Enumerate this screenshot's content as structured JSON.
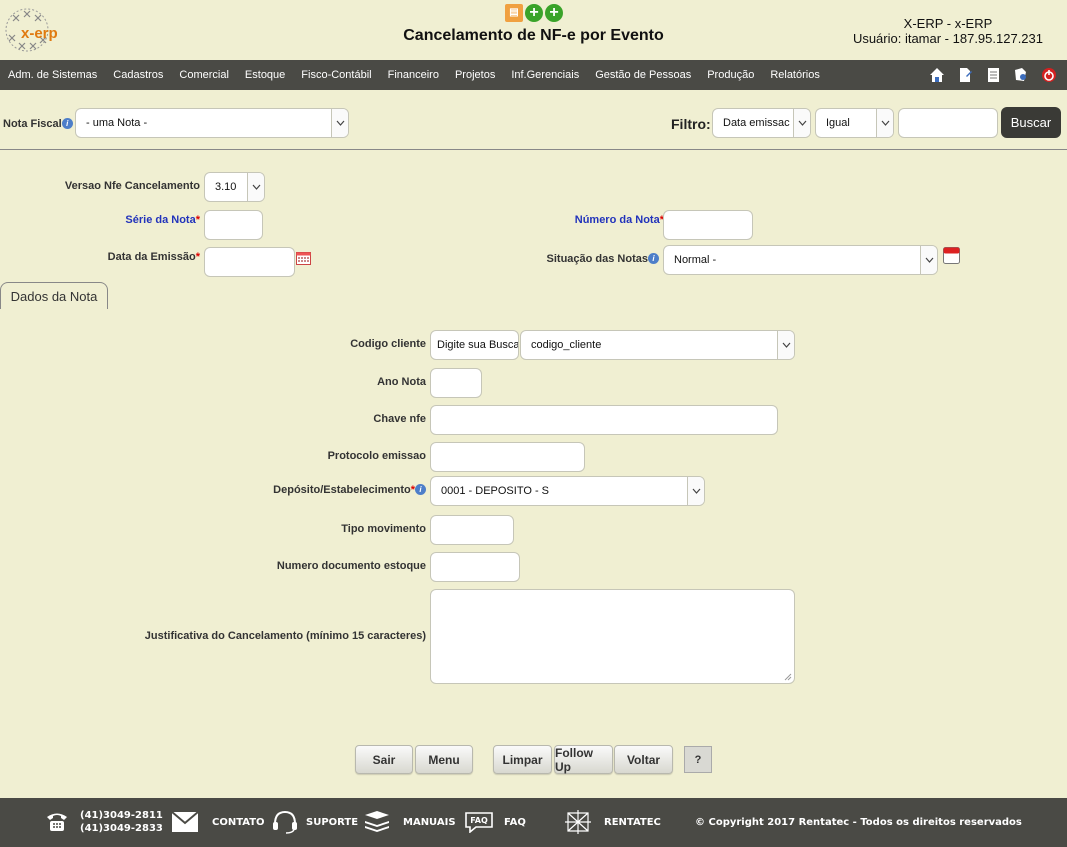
{
  "header": {
    "logo_text": "x-erp",
    "title": "Cancelamento de NF-e por Evento",
    "system": "X-ERP - x-ERP",
    "user": "Usuário: itamar - 187.95.127.231"
  },
  "menu": {
    "items": [
      "Adm. de Sistemas",
      "Cadastros",
      "Comercial",
      "Estoque",
      "Fisco-Contábil",
      "Financeiro",
      "Projetos",
      "Inf.Gerenciais",
      "Gestão de Pessoas",
      "Produção",
      "Relatórios"
    ],
    "icons": [
      "home-icon",
      "document-edit-icon",
      "document-icon",
      "search-docs-icon",
      "power-icon"
    ]
  },
  "filterbar": {
    "nota_label": "Nota Fiscal",
    "nota_value": "- uma Nota -",
    "filtro_label": "Filtro:",
    "filtro_field": "Data emissac",
    "filtro_op": "Igual",
    "filtro_value": "",
    "buscar_label": "Buscar"
  },
  "form": {
    "versao_label": "Versao Nfe Cancelamento",
    "versao_value": "3.10",
    "serie_label": "Série da Nota",
    "numero_label": "Número da Nota",
    "data_label": "Data da Emissão",
    "situacao_label": "Situação das Notas",
    "situacao_value": "Normal -"
  },
  "tab": {
    "label": "Dados da Nota"
  },
  "dados": {
    "codigo_label": "Codigo cliente",
    "codigo_search_placeholder": "Digite sua Busca",
    "codigo_select": "codigo_cliente",
    "ano_label": "Ano Nota",
    "chave_label": "Chave nfe",
    "protocolo_label": "Protocolo emissao",
    "deposito_label": "Depósito/Estabelecimento",
    "deposito_value": "0001 - DEPOSITO - S",
    "tipo_label": "Tipo movimento",
    "numdoc_label": "Numero documento estoque",
    "justificativa_label": "Justificativa do Cancelamento (mínimo 15 caracteres)"
  },
  "buttons": {
    "sair": "Sair",
    "menu": "Menu",
    "limpar": "Limpar",
    "followup": "Follow Up",
    "voltar": "Voltar",
    "help": "?"
  },
  "footer": {
    "phone1": "(41)3049-2811",
    "phone2": "(41)3049-2833",
    "contato": "CONTATO",
    "suporte": "SUPORTE",
    "manuais": "MANUAIS",
    "faq_badge": "FAQ",
    "faq": "FAQ",
    "rentatec": "RENTATEC",
    "copyright": "© Copyright 2017 Rentatec - Todos os direitos reservados"
  }
}
